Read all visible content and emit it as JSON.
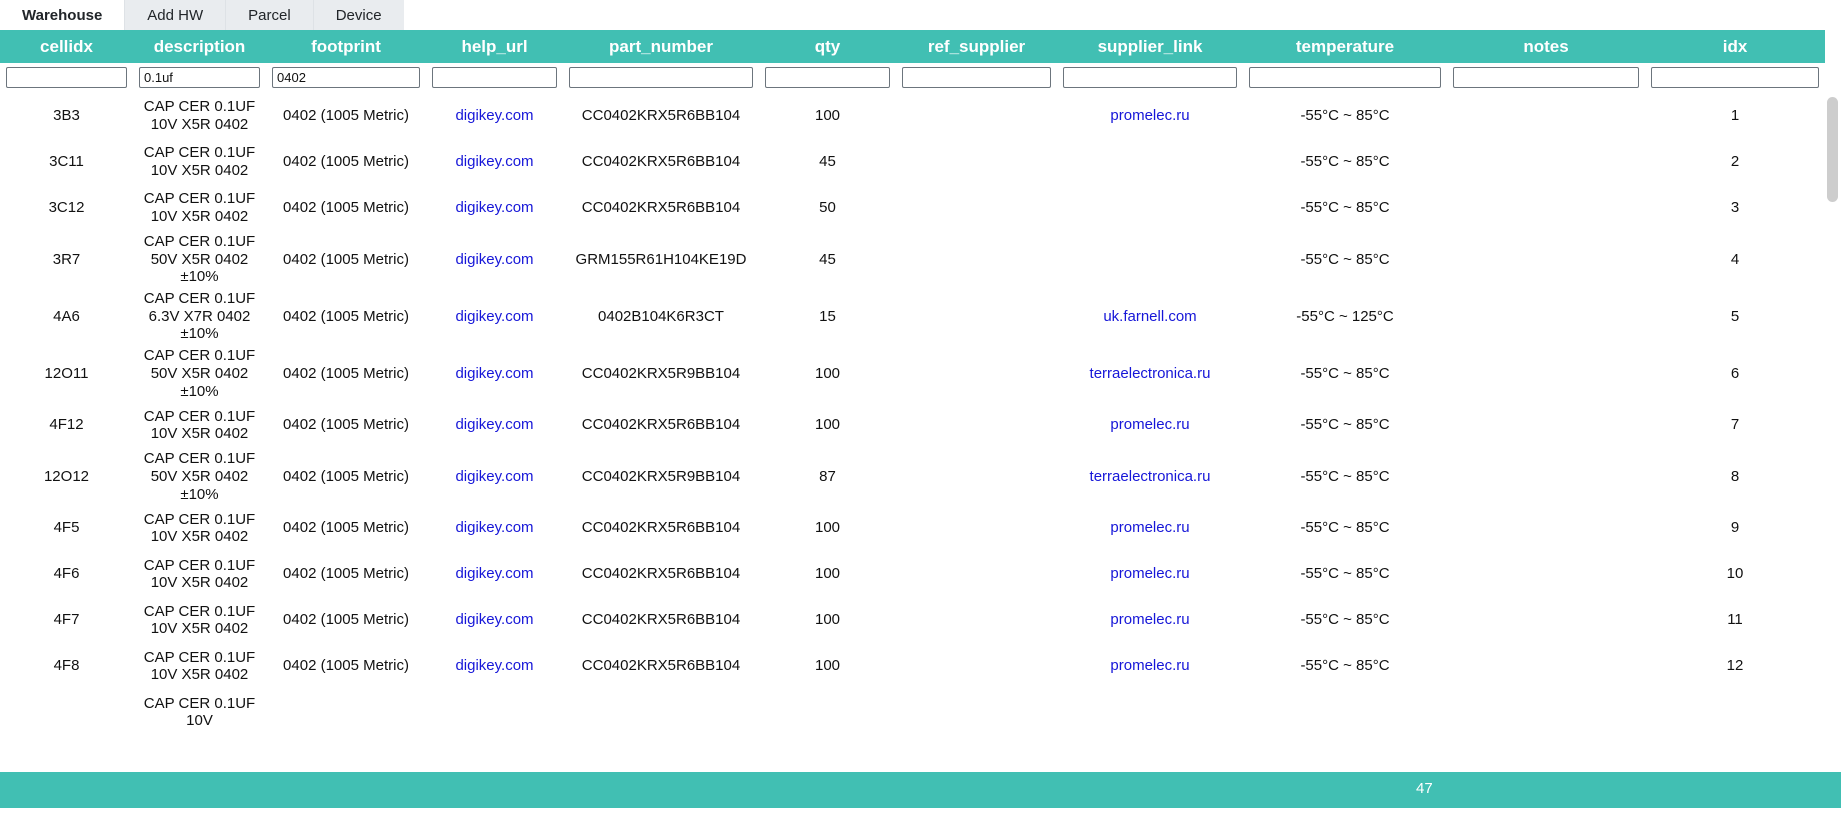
{
  "nav": {
    "tabs": [
      {
        "label": "Warehouse",
        "active": true
      },
      {
        "label": "Add HW",
        "active": false
      },
      {
        "label": "Parcel",
        "active": false
      },
      {
        "label": "Device",
        "active": false
      }
    ]
  },
  "colors": {
    "accent": "#41bfb3",
    "link": "#1616d8",
    "header_text": "#ffffff",
    "tab_inactive_bg": "#e9ecef",
    "scrollbar_thumb": "#cdcdcd"
  },
  "table": {
    "columns": [
      {
        "key": "cellidx",
        "label": "cellidx"
      },
      {
        "key": "description",
        "label": "description"
      },
      {
        "key": "footprint",
        "label": "footprint"
      },
      {
        "key": "help_url",
        "label": "help_url"
      },
      {
        "key": "part_number",
        "label": "part_number"
      },
      {
        "key": "qty",
        "label": "qty"
      },
      {
        "key": "ref_supplier",
        "label": "ref_supplier"
      },
      {
        "key": "supplier_link",
        "label": "supplier_link"
      },
      {
        "key": "temperature",
        "label": "temperature"
      },
      {
        "key": "notes",
        "label": "notes"
      },
      {
        "key": "idx",
        "label": "idx"
      }
    ],
    "filters": {
      "cellidx": "",
      "description": "0.1uf",
      "footprint": "0402",
      "help_url": "",
      "part_number": "",
      "qty": "",
      "ref_supplier": "",
      "supplier_link": "",
      "temperature": "",
      "notes": "",
      "idx": ""
    },
    "filter_placeholders": {
      "cellidx": "",
      "description": "",
      "footprint": "",
      "help_url": "",
      "part_number": "",
      "qty": "",
      "ref_supplier": "",
      "supplier_link": "",
      "temperature": "",
      "notes": "",
      "idx": ""
    },
    "rows": [
      {
        "cellidx": "3B3",
        "description": "CAP CER 0.1UF 10V X5R 0402",
        "footprint": "0402 (1005 Metric)",
        "help_url": "digikey.com",
        "part_number": "CC0402KRX5R6BB104",
        "qty": "100",
        "ref_supplier": "",
        "supplier_link": "promelec.ru",
        "temperature": "-55°C ~ 85°C",
        "notes": "",
        "idx": "1"
      },
      {
        "cellidx": "3C11",
        "description": "CAP CER 0.1UF 10V X5R 0402",
        "footprint": "0402 (1005 Metric)",
        "help_url": "digikey.com",
        "part_number": "CC0402KRX5R6BB104",
        "qty": "45",
        "ref_supplier": "",
        "supplier_link": "",
        "temperature": "-55°C ~ 85°C",
        "notes": "",
        "idx": "2"
      },
      {
        "cellidx": "3C12",
        "description": "CAP CER 0.1UF 10V X5R 0402",
        "footprint": "0402 (1005 Metric)",
        "help_url": "digikey.com",
        "part_number": "CC0402KRX5R6BB104",
        "qty": "50",
        "ref_supplier": "",
        "supplier_link": "",
        "temperature": "-55°C ~ 85°C",
        "notes": "",
        "idx": "3"
      },
      {
        "cellidx": "3R7",
        "description": "CAP CER 0.1UF 50V X5R 0402 ±10%",
        "footprint": "0402 (1005 Metric)",
        "help_url": "digikey.com",
        "part_number": "GRM155R61H104KE19D",
        "qty": "45",
        "ref_supplier": "",
        "supplier_link": "",
        "temperature": "-55°C ~ 85°C",
        "notes": "",
        "idx": "4"
      },
      {
        "cellidx": "4A6",
        "description": "CAP CER 0.1UF 6.3V X7R 0402 ±10%",
        "footprint": "0402 (1005 Metric)",
        "help_url": "digikey.com",
        "part_number": "0402B104K6R3CT",
        "qty": "15",
        "ref_supplier": "",
        "supplier_link": "uk.farnell.com",
        "temperature": "-55°C ~ 125°C",
        "notes": "",
        "idx": "5"
      },
      {
        "cellidx": "12O11",
        "description": "CAP CER 0.1UF 50V X5R 0402 ±10%",
        "footprint": "0402 (1005 Metric)",
        "help_url": "digikey.com",
        "part_number": "CC0402KRX5R9BB104",
        "qty": "100",
        "ref_supplier": "",
        "supplier_link": "terraelectronica.ru",
        "temperature": "-55°C ~ 85°C",
        "notes": "",
        "idx": "6"
      },
      {
        "cellidx": "4F12",
        "description": "CAP CER 0.1UF 10V X5R 0402",
        "footprint": "0402 (1005 Metric)",
        "help_url": "digikey.com",
        "part_number": "CC0402KRX5R6BB104",
        "qty": "100",
        "ref_supplier": "",
        "supplier_link": "promelec.ru",
        "temperature": "-55°C ~ 85°C",
        "notes": "",
        "idx": "7"
      },
      {
        "cellidx": "12O12",
        "description": "CAP CER 0.1UF 50V X5R 0402 ±10%",
        "footprint": "0402 (1005 Metric)",
        "help_url": "digikey.com",
        "part_number": "CC0402KRX5R9BB104",
        "qty": "87",
        "ref_supplier": "",
        "supplier_link": "terraelectronica.ru",
        "temperature": "-55°C ~ 85°C",
        "notes": "",
        "idx": "8"
      },
      {
        "cellidx": "4F5",
        "description": "CAP CER 0.1UF 10V X5R 0402",
        "footprint": "0402 (1005 Metric)",
        "help_url": "digikey.com",
        "part_number": "CC0402KRX5R6BB104",
        "qty": "100",
        "ref_supplier": "",
        "supplier_link": "promelec.ru",
        "temperature": "-55°C ~ 85°C",
        "notes": "",
        "idx": "9"
      },
      {
        "cellidx": "4F6",
        "description": "CAP CER 0.1UF 10V X5R 0402",
        "footprint": "0402 (1005 Metric)",
        "help_url": "digikey.com",
        "part_number": "CC0402KRX5R6BB104",
        "qty": "100",
        "ref_supplier": "",
        "supplier_link": "promelec.ru",
        "temperature": "-55°C ~ 85°C",
        "notes": "",
        "idx": "10"
      },
      {
        "cellidx": "4F7",
        "description": "CAP CER 0.1UF 10V X5R 0402",
        "footprint": "0402 (1005 Metric)",
        "help_url": "digikey.com",
        "part_number": "CC0402KRX5R6BB104",
        "qty": "100",
        "ref_supplier": "",
        "supplier_link": "promelec.ru",
        "temperature": "-55°C ~ 85°C",
        "notes": "",
        "idx": "11"
      },
      {
        "cellidx": "4F8",
        "description": "CAP CER 0.1UF 10V X5R 0402",
        "footprint": "0402 (1005 Metric)",
        "help_url": "digikey.com",
        "part_number": "CC0402KRX5R6BB104",
        "qty": "100",
        "ref_supplier": "",
        "supplier_link": "promelec.ru",
        "temperature": "-55°C ~ 85°C",
        "notes": "",
        "idx": "12"
      },
      {
        "cellidx": "",
        "description": "CAP CER 0.1UF 10V",
        "footprint": "",
        "help_url": "",
        "part_number": "",
        "qty": "",
        "ref_supplier": "",
        "supplier_link": "",
        "temperature": "",
        "notes": "",
        "idx": ""
      }
    ]
  },
  "footer": {
    "count": "47"
  }
}
